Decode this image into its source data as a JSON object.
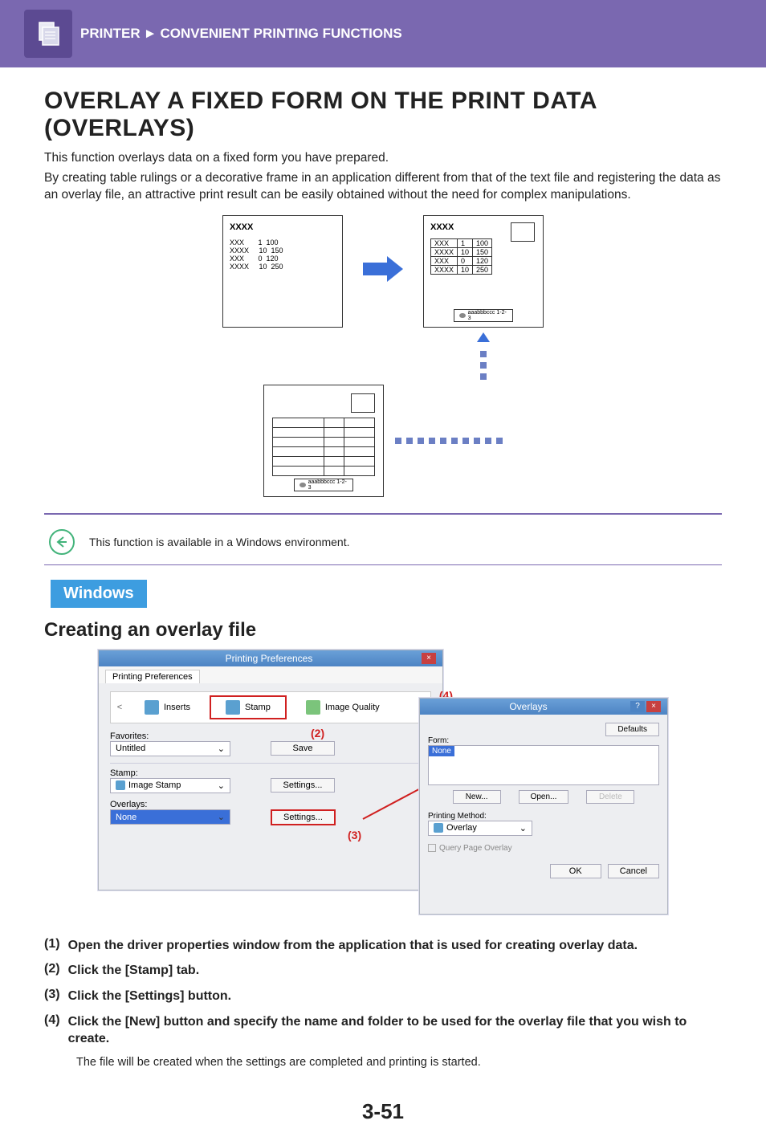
{
  "header": {
    "category": "PRINTER",
    "section": "CONVENIENT PRINTING FUNCTIONS"
  },
  "title": "OVERLAY A FIXED FORM ON THE PRINT DATA (OVERLAYS)",
  "intro_line1": "This function overlays data on a fixed form you have prepared.",
  "intro_line2": "By creating table rulings or a decorative frame in an application different from that of the text file and registering the data as an overlay file, an attractive print result can be easily obtained without the need for complex manipulations.",
  "diagram": {
    "doc_title": "XXXX",
    "rows": [
      [
        "XXX",
        "1",
        "100"
      ],
      [
        "XXXX",
        "10",
        "150"
      ],
      [
        "XXX",
        "0",
        "120"
      ],
      [
        "XXXX",
        "10",
        "250"
      ]
    ],
    "footer_chip": "aaabbbccc 1-2-3"
  },
  "note": "This function is available in a Windows environment.",
  "os_tag": "Windows",
  "subheading": "Creating an overlay file",
  "screenshot": {
    "main_title": "Printing Preferences",
    "tab_label": "Printing Preferences",
    "nav_prev": "<",
    "tab_inserts": "Inserts",
    "tab_stamp": "Stamp",
    "tab_image_quality": "Image Quality",
    "favorites_label": "Favorites:",
    "favorites_value": "Untitled",
    "save_btn": "Save",
    "stamp_label": "Stamp:",
    "stamp_value": "Image Stamp",
    "settings_btn": "Settings...",
    "overlays_label": "Overlays:",
    "overlays_value": "None",
    "annot2": "(2)",
    "annot3": "(3)",
    "annot4": "(4)",
    "popup": {
      "title": "Overlays",
      "defaults_btn": "Defaults",
      "form_label": "Form:",
      "form_value": "None",
      "new_btn": "New...",
      "open_btn": "Open...",
      "delete_btn": "Delete",
      "pm_label": "Printing Method:",
      "pm_value": "Overlay",
      "query_label": "Query Page Overlay",
      "ok": "OK",
      "cancel": "Cancel"
    }
  },
  "steps": {
    "s1": "Open the driver properties window from the application that is used for creating overlay data.",
    "s2": "Click the [Stamp] tab.",
    "s3": "Click the [Settings] button.",
    "s4": "Click the [New] button and specify the name and folder to be used for the overlay file that you wish to create.",
    "s4_note": "The file will be created when the settings are completed and printing is started."
  },
  "page_number": "3-51"
}
